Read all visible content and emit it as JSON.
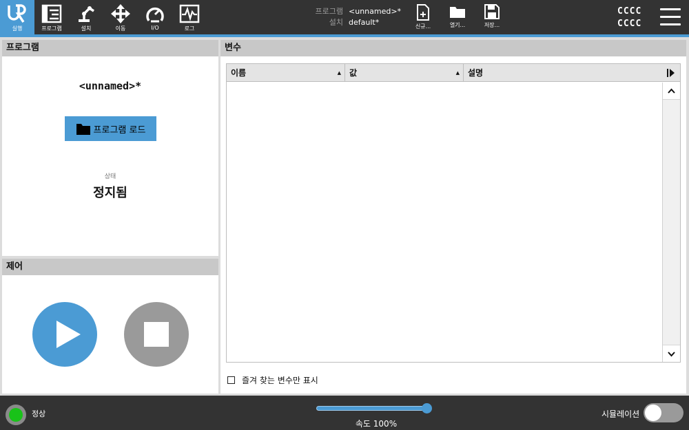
{
  "nav": [
    {
      "id": "run",
      "label": "실행",
      "icon": "ur-logo-icon",
      "active": true
    },
    {
      "id": "program",
      "label": "프로그램",
      "icon": "program-tree-icon"
    },
    {
      "id": "install",
      "label": "설치",
      "icon": "robot-arm-icon"
    },
    {
      "id": "move",
      "label": "이동",
      "icon": "move-arrows-icon"
    },
    {
      "id": "io",
      "label": "I/O",
      "icon": "io-gauge-icon"
    },
    {
      "id": "log",
      "label": "로그",
      "icon": "log-chart-icon"
    }
  ],
  "program_info": {
    "program_key": "프로그램",
    "program_value": "<unnamed>*",
    "install_key": "설치",
    "install_value": "default*"
  },
  "file_buttons": {
    "new_label": "신규...",
    "open_label": "열기...",
    "save_label": "저장..."
  },
  "robot_id": {
    "line1": "CCCC",
    "line2": "CCCC"
  },
  "program_panel": {
    "title": "프로그램",
    "program_name": "<unnamed>*",
    "load_label": "프로그램 로드",
    "status_label": "상태",
    "status_value": "정지됨"
  },
  "control_panel": {
    "title": "제어"
  },
  "variables_panel": {
    "title": "변수",
    "columns": [
      "이름",
      "값",
      "설명"
    ],
    "rows": [],
    "favorites_only_label": "즐겨 찾는 변수만 표시"
  },
  "footer": {
    "status_text": "정상",
    "speed_label": "속도 100%",
    "speed_fraction": 1.0,
    "simulation_label": "시뮬레이션",
    "simulation_on": false
  },
  "colors": {
    "accent": "#4b9bd4",
    "bar": "#333333",
    "ok": "#19c219",
    "stop": "#9a9a9a"
  }
}
